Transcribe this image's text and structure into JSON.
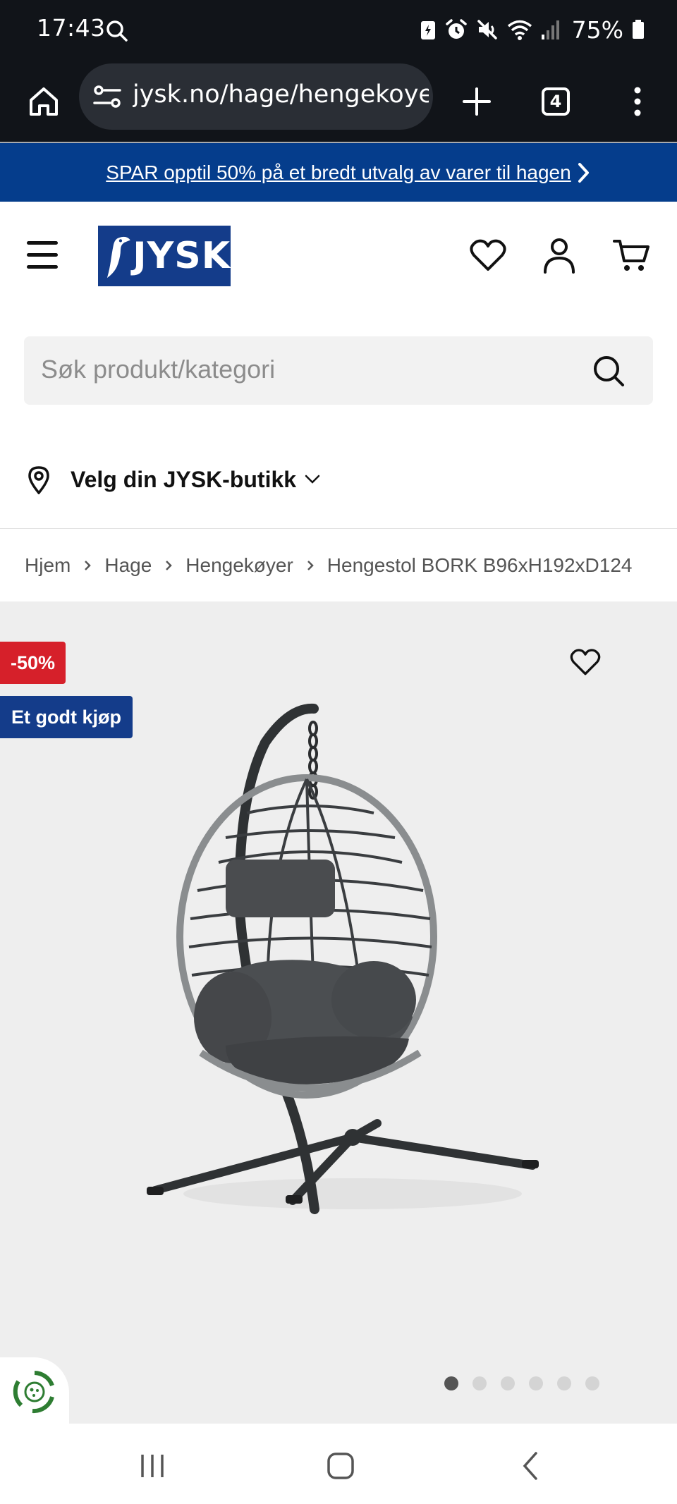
{
  "status_bar": {
    "time": "17:43",
    "battery": "75%"
  },
  "browser": {
    "url": "jysk.no/hage/hengekoye",
    "tab_count": "4"
  },
  "promo": {
    "text": "SPAR opptil 50% på et bredt utvalg av varer til hagen"
  },
  "header": {
    "logo_text": "JYSK",
    "brand_color": "#143c8a"
  },
  "search": {
    "placeholder": "Søk produkt/kategori"
  },
  "store": {
    "label": "Velg din JYSK-butikk"
  },
  "breadcrumb": {
    "items": [
      "Hjem",
      "Hage",
      "Hengekøyer",
      "Hengestol BORK B96xH192xD124"
    ]
  },
  "product": {
    "discount_badge": "-50%",
    "deal_badge": "Et godt kjøp",
    "image_count": 6,
    "active_image": 1,
    "discount_color": "#d6202a"
  }
}
